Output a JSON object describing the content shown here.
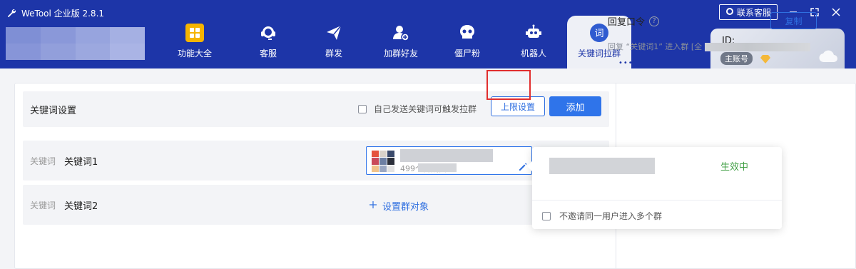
{
  "app": {
    "title": "WeTool 企业版 2.8.1",
    "service_label": "联系客服"
  },
  "nav": {
    "items": [
      {
        "label": "功能大全",
        "icon": "grid-icon"
      },
      {
        "label": "客服",
        "icon": "headset-icon"
      },
      {
        "label": "群发",
        "icon": "paper-plane-icon"
      },
      {
        "label": "加群好友",
        "icon": "add-user-icon"
      },
      {
        "label": "僵尸粉",
        "icon": "skull-icon"
      },
      {
        "label": "机器人",
        "icon": "robot-icon"
      },
      {
        "label": "关键词拉群",
        "icon": "keyword-icon",
        "icon_text": "词",
        "active": true
      }
    ],
    "more": "•••"
  },
  "account": {
    "id_label": "ID:",
    "role": "主账号"
  },
  "keyword_settings": {
    "title": "关键词设置",
    "self_trigger_label": "自己发送关键词可触发拉群",
    "limit_button": "上限设置",
    "add_button": "添加"
  },
  "keywords": [
    {
      "label": "关键词",
      "value": "关键词1",
      "group_members": "499个群成员"
    },
    {
      "label": "关键词",
      "value": "关键词2",
      "action": "设置群对象"
    }
  ],
  "reply": {
    "title": "回复口令",
    "help": "?",
    "copy_button": "复制",
    "text": "回复 “关键词1” 进入群 [全"
  },
  "popover": {
    "status": "生效中",
    "option_label": "不邀请同一用户进入多个群"
  },
  "colors": {
    "header_bg": "#1d35a8",
    "primary": "#2f74ea",
    "active_green": "#43a047",
    "highlight_red": "#e12e2e"
  }
}
